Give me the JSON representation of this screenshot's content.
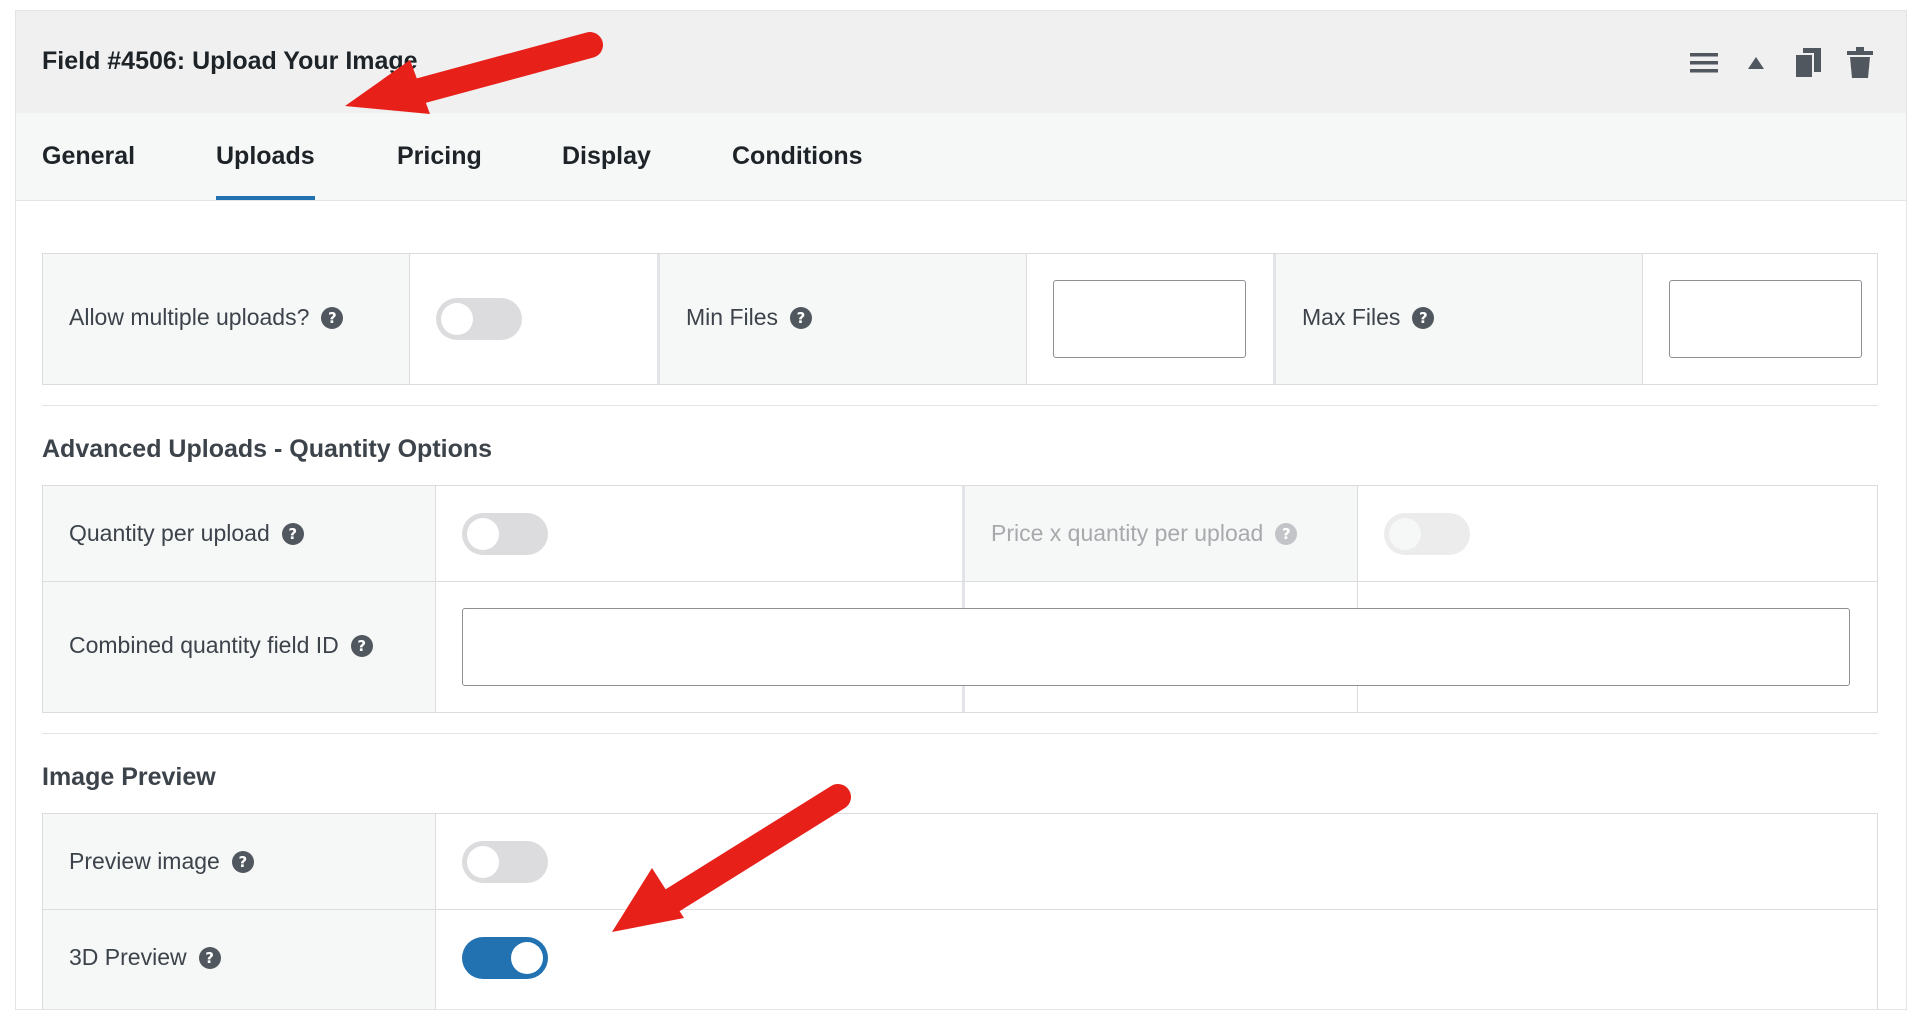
{
  "field": {
    "title": "Field #4506: Upload Your Image"
  },
  "header_icons": [
    "menu-icon",
    "collapse-up-icon",
    "copy-icon",
    "trash-icon"
  ],
  "tabs": [
    {
      "label": "General",
      "active": false
    },
    {
      "label": "Uploads",
      "active": true
    },
    {
      "label": "Pricing",
      "active": false
    },
    {
      "label": "Display",
      "active": false
    },
    {
      "label": "Conditions",
      "active": false
    }
  ],
  "uploads": {
    "allow_multiple_label": "Allow multiple uploads?",
    "allow_multiple_on": false,
    "min_files_label": "Min Files",
    "min_files_value": "",
    "max_files_label": "Max Files",
    "max_files_value": ""
  },
  "quantity_section": {
    "title": "Advanced Uploads - Quantity Options",
    "quantity_per_upload_label": "Quantity per upload",
    "quantity_per_upload_on": false,
    "price_x_quantity_label": "Price x quantity per upload",
    "price_x_quantity_on": false,
    "price_x_quantity_disabled": true,
    "combined_field_label": "Combined quantity field ID",
    "combined_field_value": ""
  },
  "preview_section": {
    "title": "Image Preview",
    "preview_image_label": "Preview image",
    "preview_image_on": false,
    "preview_3d_label": "3D Preview",
    "preview_3d_on": true
  },
  "help_glyph": "?",
  "colors": {
    "accent": "#2271b1",
    "annotation_arrow": "#e8201a",
    "header_bg": "#f0f0f1"
  }
}
